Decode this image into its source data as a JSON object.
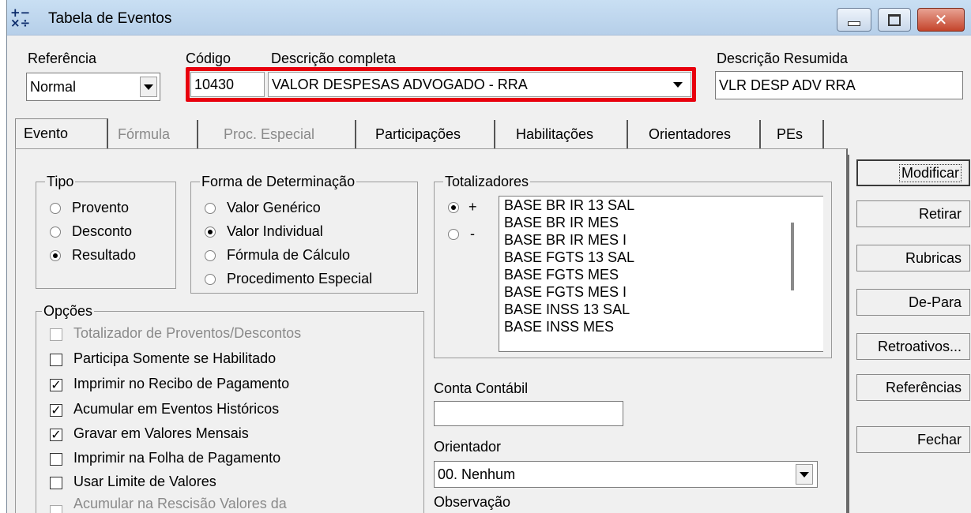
{
  "window": {
    "title": "Tabela de Eventos",
    "minimize_glyph": "▭",
    "maximize_glyph": "▣",
    "close_glyph": "✕"
  },
  "header": {
    "referencia_label": "Referência",
    "referencia_value": "Normal",
    "codigo_label": "Código",
    "codigo_value": "10430",
    "descricao_label": "Descrição completa",
    "descricao_value": "VALOR DESPESAS ADVOGADO - RRA",
    "resumida_label": "Descrição Resumida",
    "resumida_value": "VLR DESP ADV RRA",
    "highlight_color": "#e8000d"
  },
  "tabs": [
    "Evento",
    "Fórmula",
    "Proc. Especial",
    "Participações",
    "Habilitações",
    "Orientadores",
    "PEs"
  ],
  "tipo": {
    "title": "Tipo",
    "options": [
      "Provento",
      "Desconto",
      "Resultado"
    ],
    "selected": "Resultado"
  },
  "forma": {
    "title": "Forma de Determinação",
    "options": [
      "Valor Genérico",
      "Valor Individual",
      "Fórmula de Cálculo",
      "Procedimento Especial"
    ],
    "selected": "Valor Individual"
  },
  "totalizadores": {
    "title": "Totalizadores",
    "plus": "+",
    "minus": "-",
    "items": [
      "BASE BR IR 13  SAL",
      "BASE BR IR MES",
      "BASE BR IR MES I",
      "BASE FGTS 13 SAL",
      "BASE FGTS MES",
      "BASE FGTS MES I",
      "BASE INSS 13  SAL",
      "BASE INSS MES"
    ]
  },
  "opcoes": {
    "title": "Opções",
    "items": [
      {
        "label": "Totalizador de Proventos/Descontos",
        "checked": false,
        "enabled": false
      },
      {
        "label": "Participa Somente se Habilitado",
        "checked": false,
        "enabled": true
      },
      {
        "label": "Imprimir no Recibo de Pagamento",
        "checked": true,
        "enabled": true
      },
      {
        "label": "Acumular em Eventos Históricos",
        "checked": true,
        "enabled": true
      },
      {
        "label": "Gravar em Valores Mensais",
        "checked": true,
        "enabled": true
      },
      {
        "label": "Imprimir na Folha de Pagamento",
        "checked": false,
        "enabled": true
      },
      {
        "label": "Usar Limite de Valores",
        "checked": false,
        "enabled": true
      },
      {
        "label": "Acumular na Rescisão Valores da",
        "checked": false,
        "enabled": false
      }
    ]
  },
  "conta": {
    "label": "Conta Contábil",
    "value": ""
  },
  "orientador": {
    "label": "Orientador",
    "value": "00. Nenhum"
  },
  "observacao": {
    "label": "Observação"
  },
  "buttons": [
    "Modificar",
    "Retirar",
    "Rubricas",
    "De-Para",
    "Retroativos...",
    "Referências",
    "Fechar"
  ]
}
